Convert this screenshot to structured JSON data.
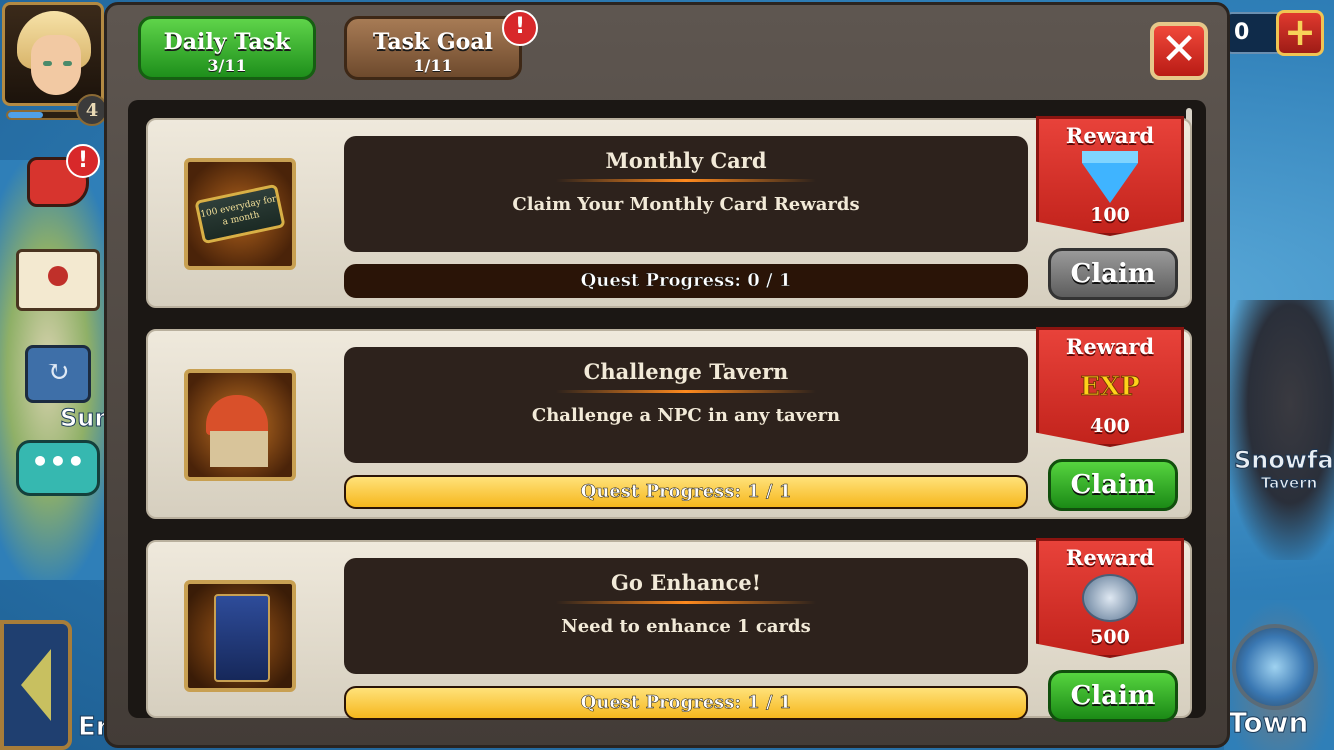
{
  "background": {
    "left_labels": [
      "Sum",
      "Er"
    ],
    "snowfall": {
      "name": "Snowfall",
      "type": "Tavern"
    },
    "town_label": "Town"
  },
  "hud": {
    "level": "4",
    "currency_value": "0",
    "plus_icon": "plus-icon"
  },
  "tabs": [
    {
      "label": "Daily Task",
      "count": "3/11",
      "active": true,
      "color": "#2fb12a"
    },
    {
      "label": "Task Goal",
      "count": "1/11",
      "active": false,
      "color": "#8a613e",
      "badge": "!"
    }
  ],
  "side_badges": {
    "megaphone": "!"
  },
  "quests": [
    {
      "title": "Monthly Card",
      "description": "Claim Your Monthly Card Rewards",
      "progress_text": "Quest Progress: 0 / 1",
      "progress": 0,
      "reward_label": "Reward",
      "reward_icon": "diamond-icon",
      "reward_value": "100",
      "claim_label": "Claim",
      "claim_enabled": false,
      "icon": "monthly-card-icon",
      "icon_text": "100 everyday for a month"
    },
    {
      "title": "Challenge Tavern",
      "description": "Challenge a NPC in any tavern",
      "progress_text": "Quest Progress: 1 / 1",
      "progress": 1,
      "reward_label": "Reward",
      "reward_icon": "exp-icon",
      "reward_icon_text": "EXP",
      "reward_value": "400",
      "claim_label": "Claim",
      "claim_enabled": true,
      "icon": "tavern-icon"
    },
    {
      "title": "Go Enhance!",
      "description": "Need to enhance 1 cards",
      "progress_text": "Quest Progress: 1 / 1",
      "progress": 1,
      "reward_label": "Reward",
      "reward_icon": "silver-coins-icon",
      "reward_value": "500",
      "claim_label": "Claim",
      "claim_enabled": true,
      "icon": "hero-card-icon"
    }
  ],
  "close_icon": "close-icon",
  "colors": {
    "claim_active": "#2fb12a",
    "claim_inactive": "#6f6f6f",
    "reward_ribbon": "#d3302a",
    "progress_fill": "#f6c02d"
  }
}
